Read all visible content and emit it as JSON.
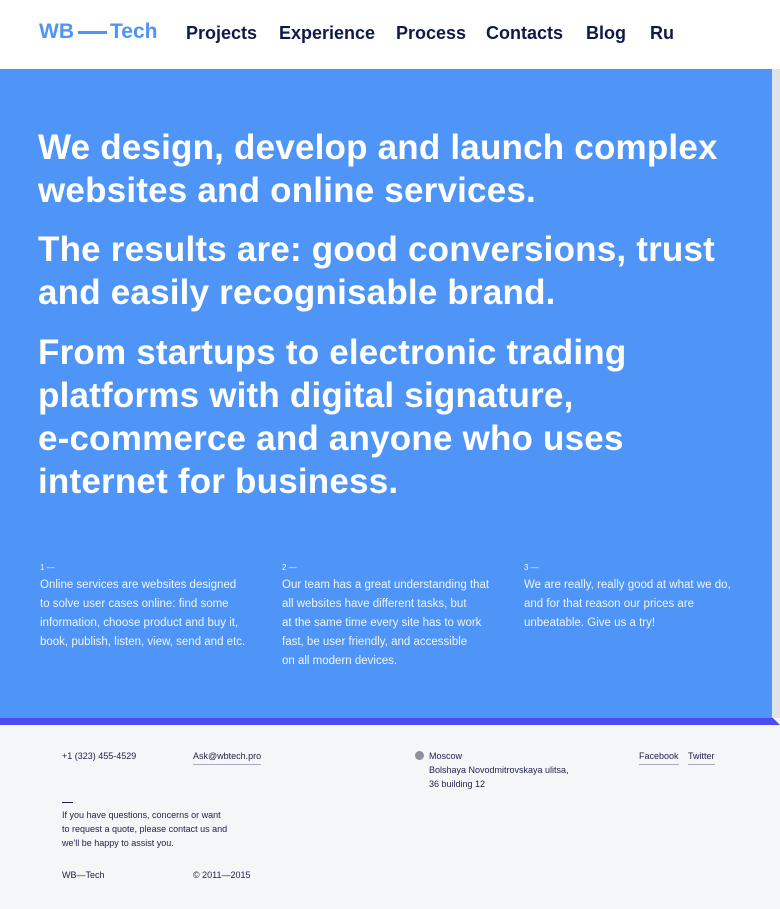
{
  "header": {
    "logo": {
      "left": "WB",
      "right": "Tech"
    },
    "nav": [
      "Projects",
      "Experience",
      "Process",
      "Contacts",
      "Blog",
      "Ru"
    ]
  },
  "hero": {
    "headline_1": [
      "We design, develop and launch complex",
      "websites and online services."
    ],
    "headline_2": [
      "The results are: good conversions, trust",
      "and easily recognisable brand."
    ],
    "headline_3": [
      "From startups to electronic trading",
      "platforms with digital signature,",
      "e-commerce and anyone who uses",
      "internet for business."
    ],
    "features": [
      {
        "number": "1 —",
        "lines": [
          "Online services are websites designed",
          "to solve user cases online: find some",
          "information, choose product and buy it,",
          "book, publish, listen, view, send and etc."
        ]
      },
      {
        "number": "2 —",
        "lines": [
          "Our team has a great understanding that",
          "all websites have different tasks, but",
          "at the same time every site has to work",
          "fast, be user friendly, and accessible",
          "on all modern devices."
        ]
      },
      {
        "number": "3 —",
        "lines": [
          "We are really, really good at what we do,",
          "and for that reason our prices are",
          "unbeatable. Give us a try!"
        ]
      }
    ]
  },
  "footer": {
    "phone": "+1 (323) 455-4529",
    "email": "Ask@wbtech.pro",
    "city": "Moscow",
    "address": [
      "Bolshaya Novodmitrovskaya ulitsa,",
      "36 building 12"
    ],
    "social": [
      "Facebook",
      "Twitter"
    ],
    "note": [
      "If you have questions, concerns or want",
      "to request a quote, please contact us and",
      "we'll be happy to assist you."
    ],
    "brand": "WB—Tech",
    "copyright": "© 2011—2015"
  },
  "colors": {
    "accent": "#4f95f7",
    "divider": "#4c4cf2",
    "nav_text": "#0d1a4a"
  },
  "icons": [
    "location-pin-icon"
  ]
}
